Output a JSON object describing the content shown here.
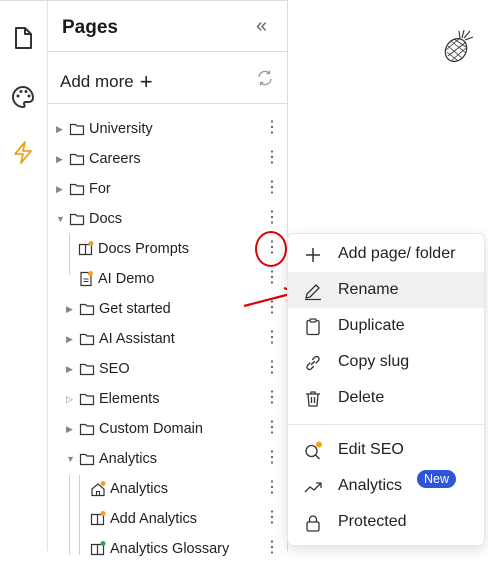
{
  "sidebar_rail": {
    "icons": [
      "page-icon",
      "palette-icon",
      "lightning-icon"
    ],
    "accent": "#f4a020"
  },
  "panel": {
    "title": "Pages",
    "collapse_glyph": "«",
    "add_more_label": "Add more",
    "add_more_plus": "+"
  },
  "tree": [
    {
      "label": "University",
      "type": "folder",
      "depth": 0,
      "expanded": false
    },
    {
      "label": "Careers",
      "type": "folder",
      "depth": 0,
      "expanded": false
    },
    {
      "label": "For",
      "type": "folder",
      "depth": 0,
      "expanded": false
    },
    {
      "label": "Docs",
      "type": "folder",
      "depth": 0,
      "expanded": true
    },
    {
      "label": "Docs Prompts",
      "type": "book-page",
      "depth": 1,
      "dot": "#f4a020"
    },
    {
      "label": "AI Demo",
      "type": "doc-page",
      "depth": 1,
      "dot": "#f4a020"
    },
    {
      "label": "Get started",
      "type": "folder",
      "depth": 1,
      "expanded": false
    },
    {
      "label": "AI Assistant",
      "type": "folder",
      "depth": 1,
      "expanded": false
    },
    {
      "label": "SEO",
      "type": "folder",
      "depth": 1,
      "expanded": false
    },
    {
      "label": "Elements",
      "type": "folder",
      "depth": 1,
      "expanded": false
    },
    {
      "label": "Custom Domain",
      "type": "folder",
      "depth": 1,
      "expanded": false
    },
    {
      "label": "Analytics",
      "type": "folder",
      "depth": 1,
      "expanded": true
    },
    {
      "label": "Analytics",
      "type": "home-page",
      "depth": 2,
      "dot": "#f4a020"
    },
    {
      "label": "Add Analytics",
      "type": "book-page",
      "depth": 2,
      "dot": "#f4a020"
    },
    {
      "label": "Analytics Glossary",
      "type": "book-page",
      "depth": 2,
      "dot": "#2ea84a"
    }
  ],
  "context_menu": {
    "items": [
      {
        "label": "Add page/ folder",
        "icon": "plus-icon"
      },
      {
        "label": "Rename",
        "icon": "pencil-icon"
      },
      {
        "label": "Duplicate",
        "icon": "clipboard-icon"
      },
      {
        "label": "Copy slug",
        "icon": "link-icon"
      },
      {
        "label": "Delete",
        "icon": "trash-icon"
      },
      {
        "label": "Edit SEO",
        "icon": "search-dot-icon"
      },
      {
        "label": "Analytics",
        "icon": "trend-icon",
        "badge": "New"
      },
      {
        "label": "Protected",
        "icon": "lock-icon"
      }
    ],
    "badge_color": "#2f56d8"
  },
  "annotation_color": "#e20000"
}
